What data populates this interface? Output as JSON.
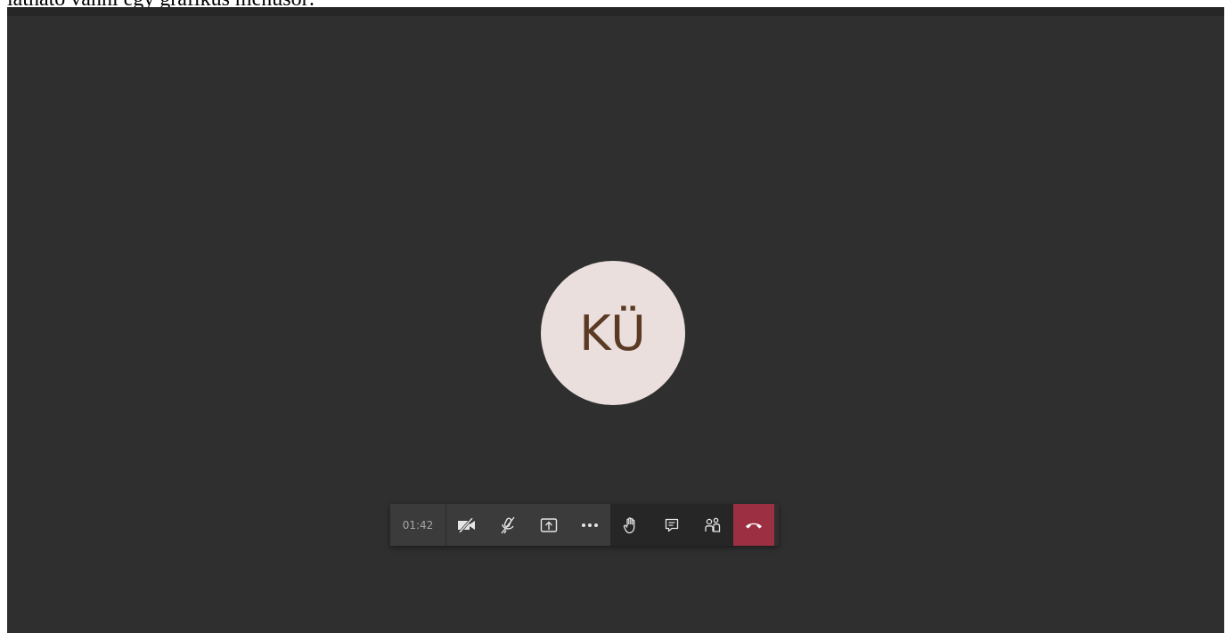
{
  "caption": {
    "text": "látható vanni egy grafikus menüsor:"
  },
  "participant": {
    "initials": "KÜ",
    "avatar_bg": "#eadfdc",
    "initials_color": "#5b3a24"
  },
  "toolbar": {
    "timer": "01:42",
    "buttons": [
      {
        "name": "camera-off",
        "icon": "video-off-icon"
      },
      {
        "name": "mic-muted",
        "icon": "mic-off-icon"
      },
      {
        "name": "share",
        "icon": "share-screen-icon"
      },
      {
        "name": "more",
        "icon": "more-icon"
      },
      {
        "name": "raise-hand",
        "icon": "hand-icon"
      },
      {
        "name": "chat",
        "icon": "chat-icon"
      },
      {
        "name": "participants",
        "icon": "people-icon"
      },
      {
        "name": "hang-up",
        "icon": "phone-hangup-icon"
      }
    ],
    "hangup_color": "#9c2f42"
  },
  "colors": {
    "stage_bg": "#2f2f2f",
    "toolbar_light": "#3b3b3b",
    "toolbar_dark": "#262626"
  }
}
